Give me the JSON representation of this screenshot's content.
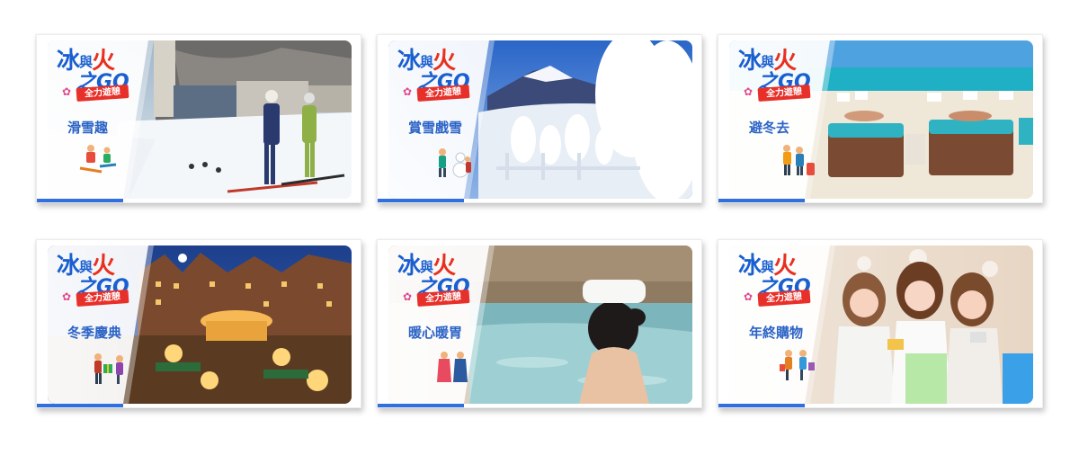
{
  "logo": {
    "line1_a": "冰",
    "line1_b": "與",
    "line1_c": "火",
    "line2": "之GO",
    "ribbon": "全力遊憩",
    "flower_icon": "flower-icon"
  },
  "cards": [
    {
      "label": "滑雪趣",
      "theme": "ski"
    },
    {
      "label": "賞雪戲雪",
      "theme": "snow"
    },
    {
      "label": "避冬去",
      "theme": "beach"
    },
    {
      "label": "冬季慶典",
      "theme": "festival"
    },
    {
      "label": "暖心暖胃",
      "theme": "onsen"
    },
    {
      "label": "年終購物",
      "theme": "shopping"
    }
  ],
  "colors": {
    "accent": "#2f6fde",
    "label": "#2b63c6",
    "fire": "#e8301f",
    "ribbon": "#e8302a"
  }
}
